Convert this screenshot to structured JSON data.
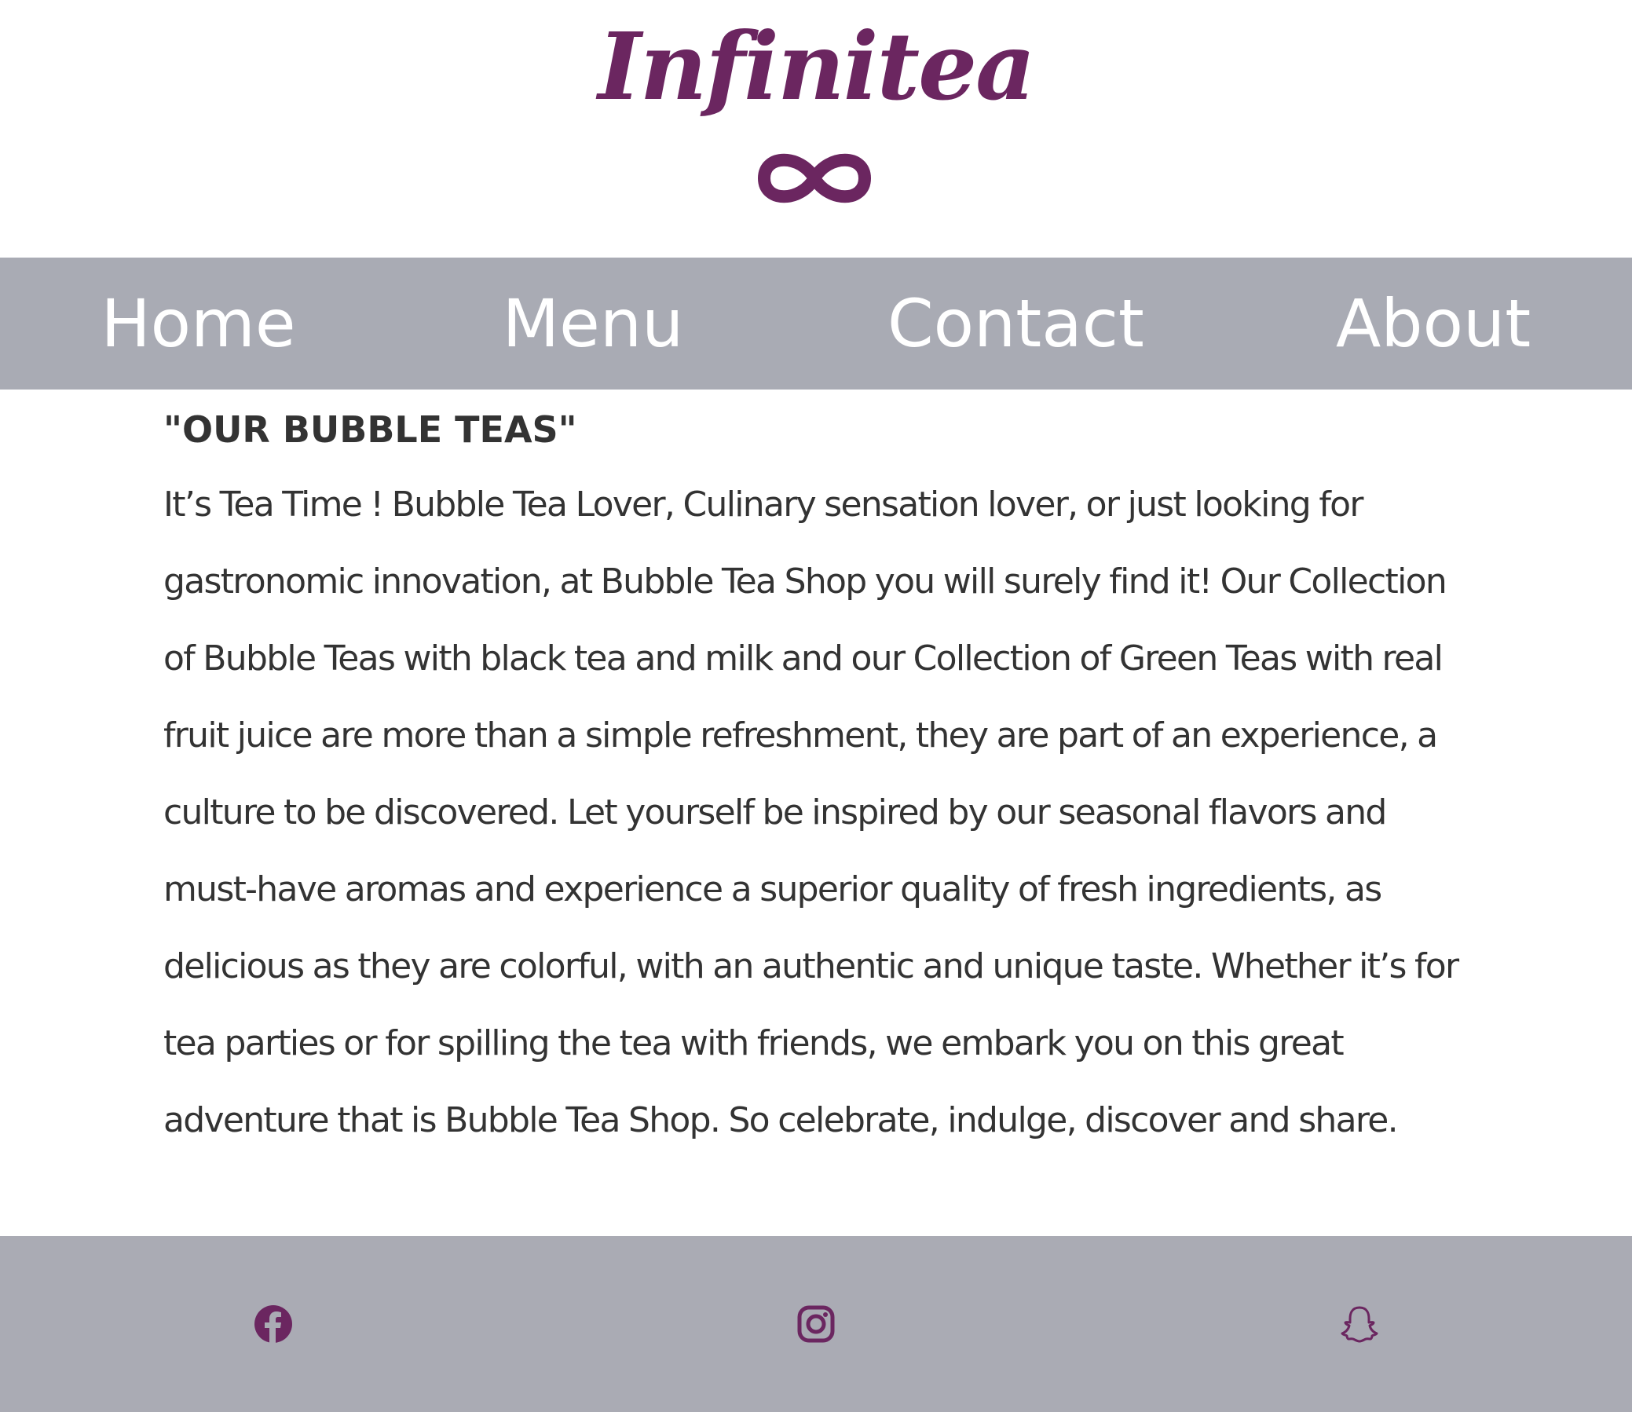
{
  "colors": {
    "brand": "#6b2660",
    "nav_bg": "#a9abb4",
    "footer_bg": "#aaabb4",
    "text": "#333333",
    "nav_text": "#ffffff"
  },
  "header": {
    "logo_text": "Infinitea",
    "logo_icon": "infinity-icon"
  },
  "nav": {
    "items": [
      {
        "label": "Home"
      },
      {
        "label": "Menu"
      },
      {
        "label": "Contact"
      },
      {
        "label": "About"
      }
    ]
  },
  "main": {
    "title": "\"OUR BUBBLE TEAS\"",
    "body": "It’s Tea Time ! Bubble Tea Lover, Culinary sensation lover, or just looking for gastronomic innovation, at Bubble Tea Shop you will surely find it! Our Collection of Bubble Teas with black tea and milk and our Collection of Green Teas with real fruit juice are more than a simple refreshment, they are part of an experience, a culture to be discovered. Let yourself be inspired by our seasonal flavors and must-have aromas and experience a superior quality of fresh ingredients, as delicious as they are colorful, with an authentic and unique taste. Whether it’s for tea parties or for spilling the tea with friends, we embark you on this great adventure that is Bubble Tea Shop. So celebrate, indulge, discover and share."
  },
  "footer": {
    "social": [
      {
        "icon": "facebook-icon"
      },
      {
        "icon": "instagram-icon"
      },
      {
        "icon": "snapchat-icon"
      }
    ]
  }
}
